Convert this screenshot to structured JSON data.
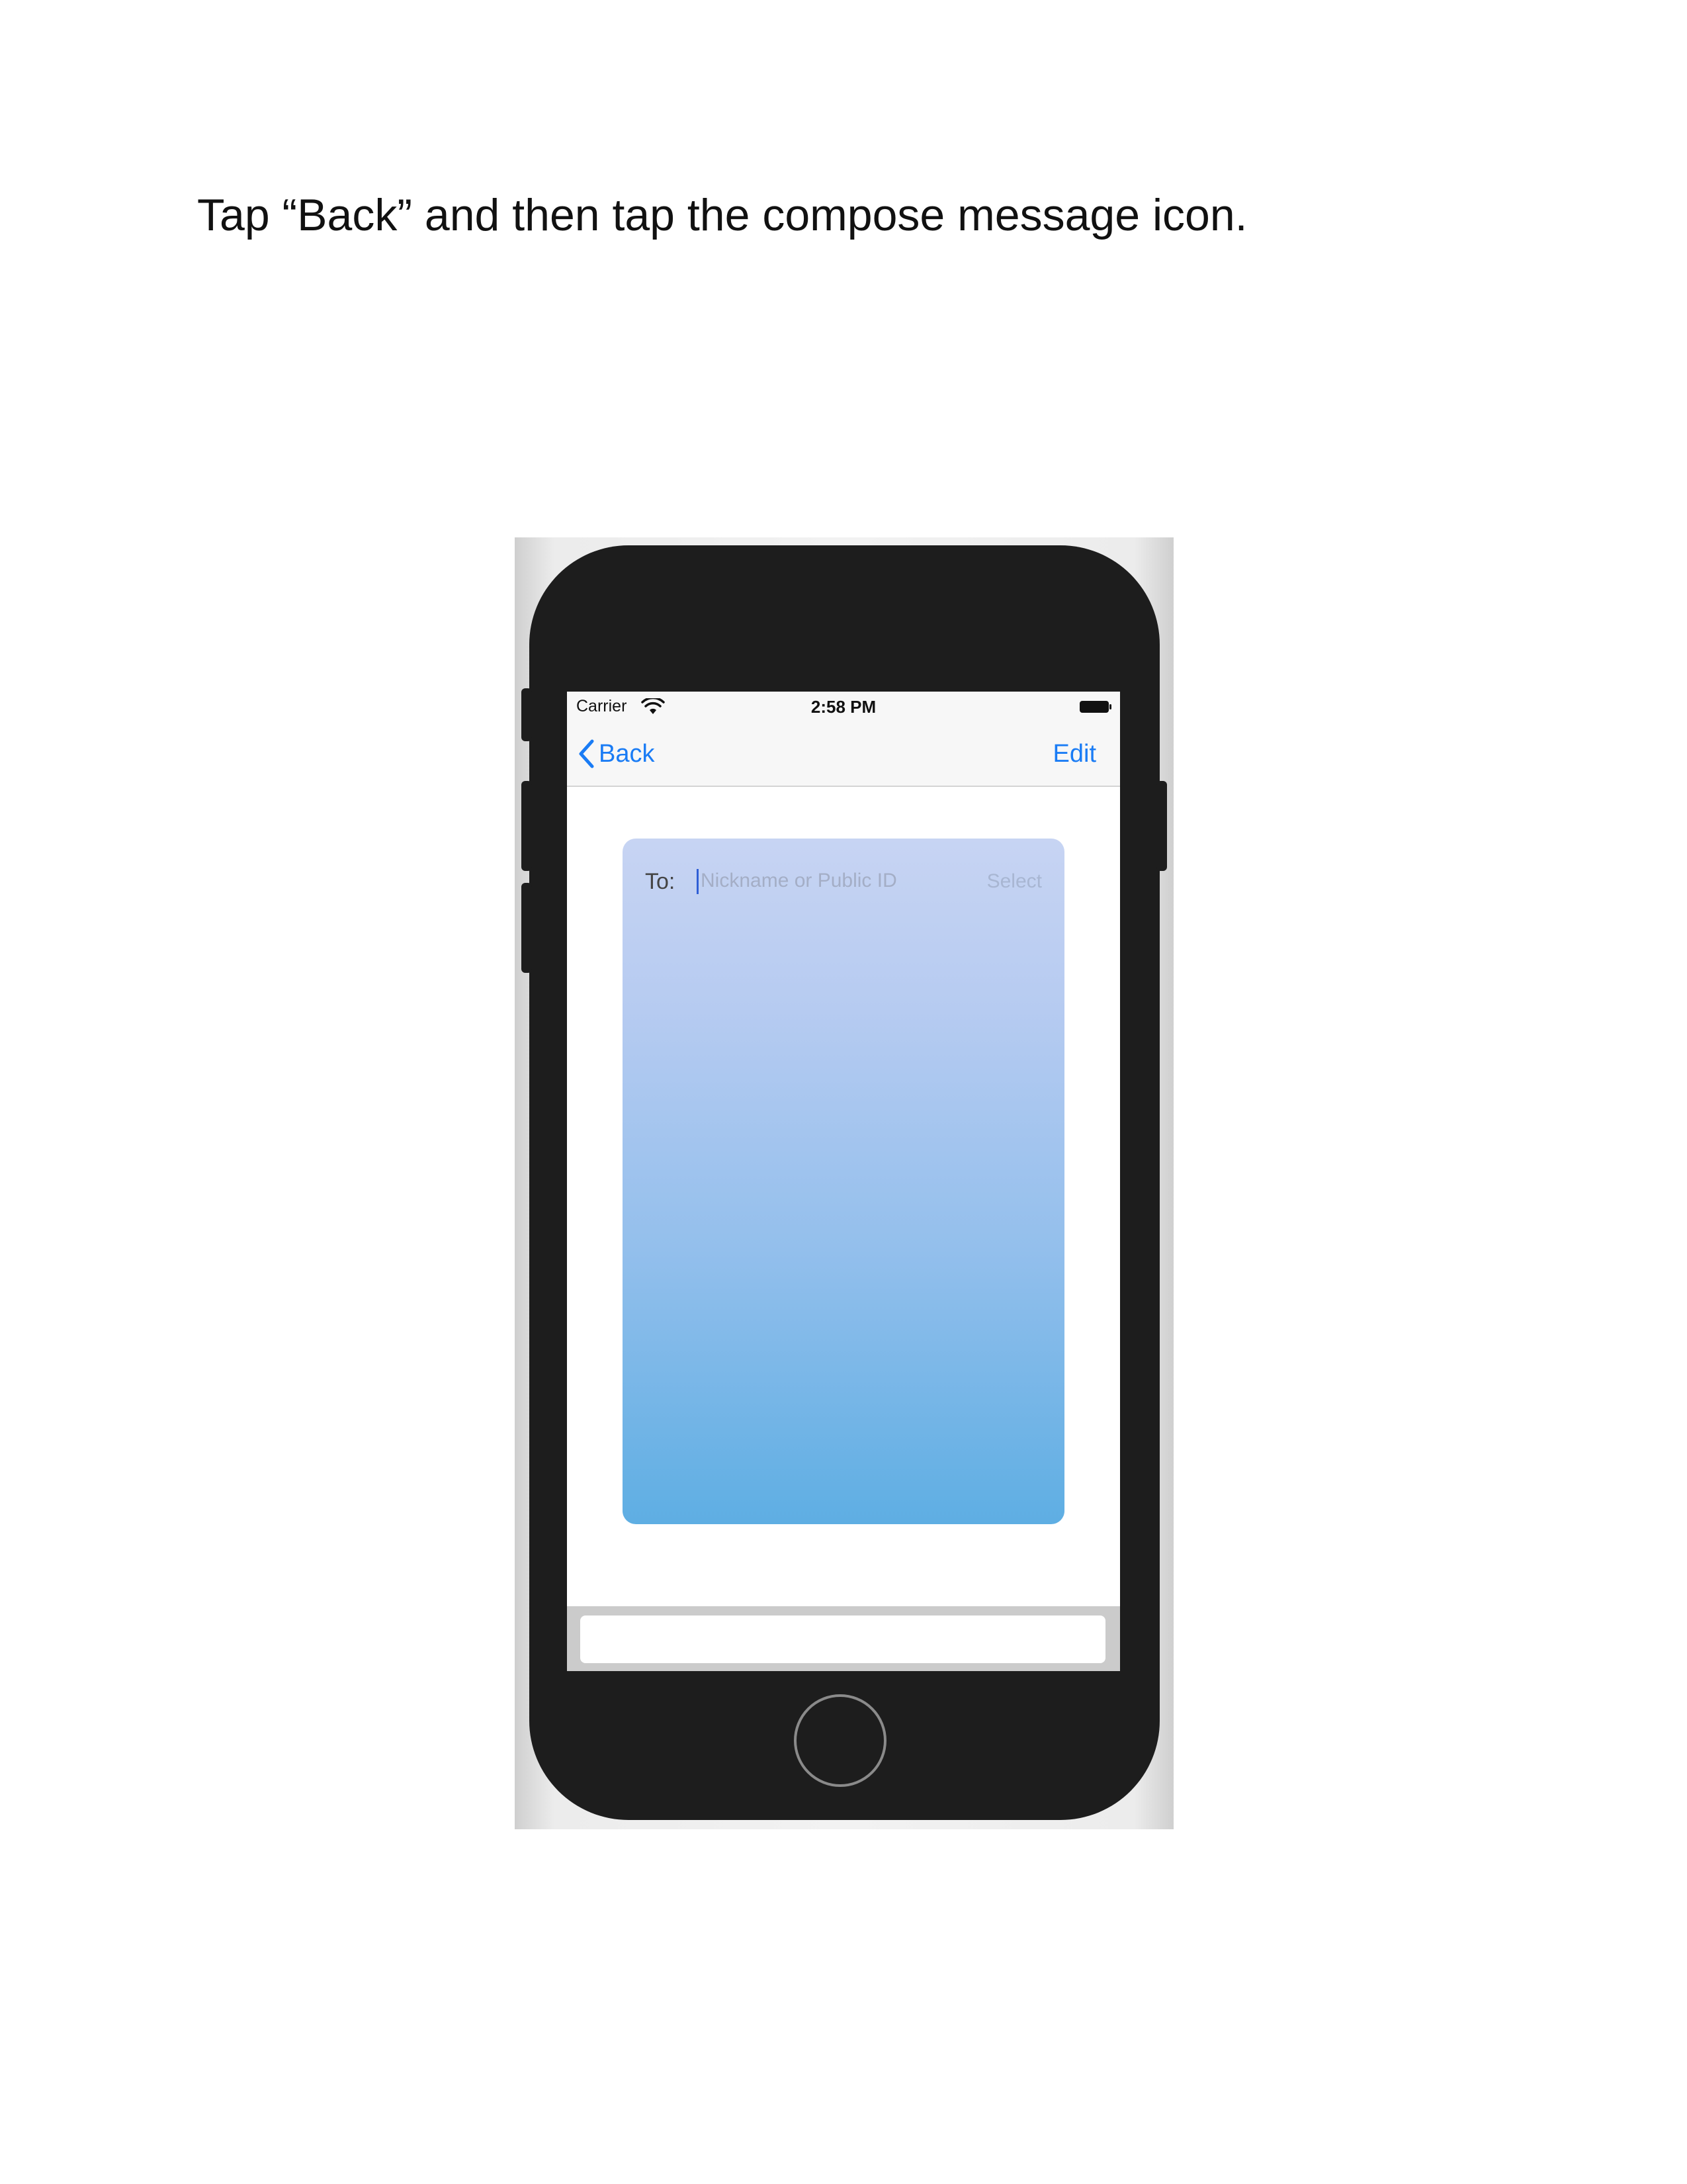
{
  "instruction": "Tap “Back” and then tap the compose message icon.",
  "status_bar": {
    "carrier": "Carrier",
    "time": "2:58 PM",
    "wifi_icon": "wifi-icon",
    "battery_icon": "battery-icon"
  },
  "nav_bar": {
    "back_label": "Back",
    "edit_label": "Edit",
    "back_icon": "chevron-left-icon"
  },
  "compose": {
    "to_label": "To:",
    "to_placeholder": "Nickname or Public ID",
    "to_value": "",
    "select_label": "Select"
  },
  "toolbar": {
    "message_value": ""
  },
  "colors": {
    "accent": "#1a7cf5",
    "card_gradient_top": "#c7d4f3",
    "card_gradient_bottom": "#5eaee3",
    "device_body": "#1d1d1d"
  }
}
